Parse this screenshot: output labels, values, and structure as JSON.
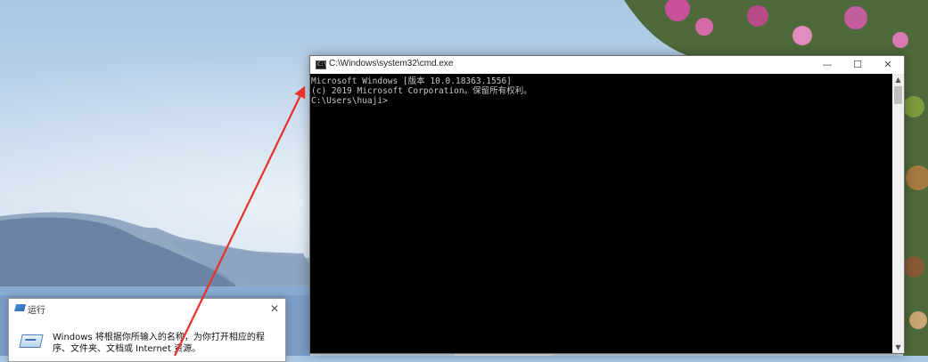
{
  "cmd_window": {
    "title": "C:\\Windows\\system32\\cmd.exe",
    "icon": "console-icon",
    "buttons": {
      "minimize": "—",
      "maximize": "☐",
      "close": "✕"
    },
    "lines": [
      "Microsoft Windows [版本 10.0.18363.1556]",
      "(c) 2019 Microsoft Corporation。保留所有权利。",
      "",
      "C:\\Users\\huaji>"
    ]
  },
  "run_dialog": {
    "title": "运行",
    "icon": "run-icon",
    "close_label": "✕",
    "description": "Windows 将根据你所输入的名称，为你打开相应的程序、文件夹、文档或 Internet 资源。"
  },
  "annotation": {
    "arrow_color": "#e8312a"
  },
  "colors": {
    "console_bg": "#000000",
    "console_text": "#c8c8c8"
  }
}
